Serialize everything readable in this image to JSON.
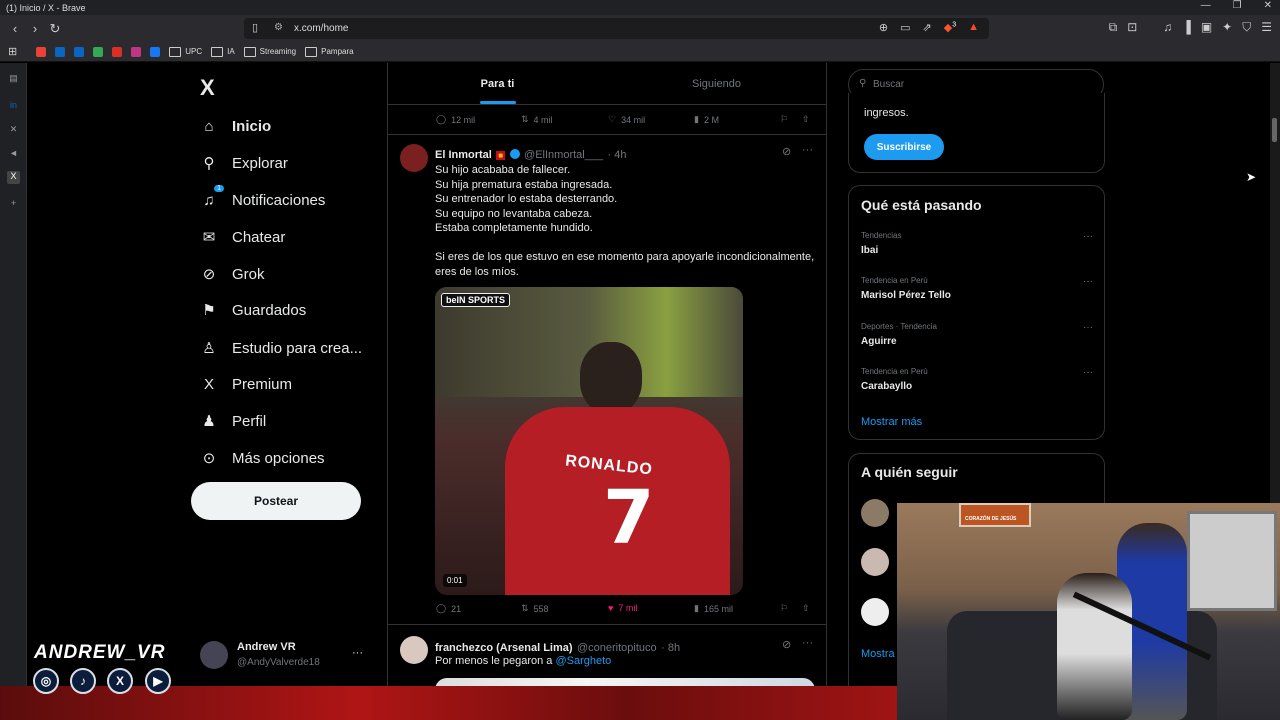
{
  "window": {
    "title": "(1) Inicio / X - Brave"
  },
  "browser": {
    "url": "x.com/home",
    "bookmarks": [
      "UPC",
      "IA",
      "Streaming",
      "Pampara"
    ],
    "brave_badge": "3"
  },
  "leftnav": {
    "logo": "X",
    "items": [
      {
        "label": "Inicio",
        "icon": "home-icon"
      },
      {
        "label": "Explorar",
        "icon": "search-icon"
      },
      {
        "label": "Notificaciones",
        "icon": "bell-icon",
        "badge": "1"
      },
      {
        "label": "Chatear",
        "icon": "mail-icon"
      },
      {
        "label": "Grok",
        "icon": "grok-icon"
      },
      {
        "label": "Guardados",
        "icon": "bookmark-icon"
      },
      {
        "label": "Estudio para crea...",
        "icon": "studio-icon"
      },
      {
        "label": "Premium",
        "icon": "x-premium-icon"
      },
      {
        "label": "Perfil",
        "icon": "person-icon"
      },
      {
        "label": "Más opciones",
        "icon": "more-circle-icon"
      }
    ],
    "post_button": "Postear",
    "profile": {
      "name": "Andrew VR",
      "handle": "@AndyValverde18"
    }
  },
  "feed": {
    "tabs": [
      "Para ti",
      "Siguiendo"
    ],
    "prev_tweet_actions": {
      "replies": "12 mil",
      "reposts": "4 mil",
      "likes": "34 mil",
      "views": "2 M"
    },
    "tweet1": {
      "name": "El Inmortal",
      "handle": "@ElInmortal___",
      "time": "· 4h",
      "text": [
        "Su hijo acababa de fallecer.",
        "Su hija prematura estaba ingresada.",
        "Su entrenador lo estaba desterrando.",
        "Su equipo no levantaba cabeza.",
        "Estaba completamente hundido.",
        "",
        "Si eres de los que estuvo en ese momento para apoyarle incondicionalmente,",
        "eres de los míos."
      ],
      "media_badge": "beIN SPORTS",
      "media_jersey_name": "RONALDO",
      "media_jersey_number": "7",
      "duration": "0:01",
      "replies": "21",
      "reposts": "558",
      "likes": "7 mil",
      "views": "165 mil"
    },
    "tweet2": {
      "name": "franchezco (Arsenal Lima)",
      "handle": "@coneritopituco",
      "time": "· 8h",
      "text_prefix": "Por menos le pegaron a ",
      "mention": "@Sargheto"
    }
  },
  "right": {
    "search_placeholder": "Buscar",
    "premium_text": "ingresos.",
    "subscribe_button": "Suscribirse",
    "trending_title": "Qué está pasando",
    "trends": [
      {
        "meta": "Tendencias",
        "name": "Ibai"
      },
      {
        "meta": "Tendencia en Perú",
        "name": "Marisol Pérez Tello"
      },
      {
        "meta": "Deportes · Tendencia",
        "name": "Aguirre"
      },
      {
        "meta": "Tendencia en Perú",
        "name": "Carabayllo"
      }
    ],
    "show_more": "Mostrar más",
    "follow_title": "A quién seguir",
    "follow_show_more": "Mostra"
  },
  "overlay": {
    "streamer_name": "ANDREW_VR",
    "socials": [
      "instagram-icon",
      "tiktok-icon",
      "x-icon",
      "youtube-icon"
    ],
    "webcam_sign": "CORAZÓN DE JESÚS"
  },
  "colors": {
    "accent": "#1d9bf0",
    "like": "#f91880",
    "background": "#000000",
    "muted": "#71767b"
  }
}
